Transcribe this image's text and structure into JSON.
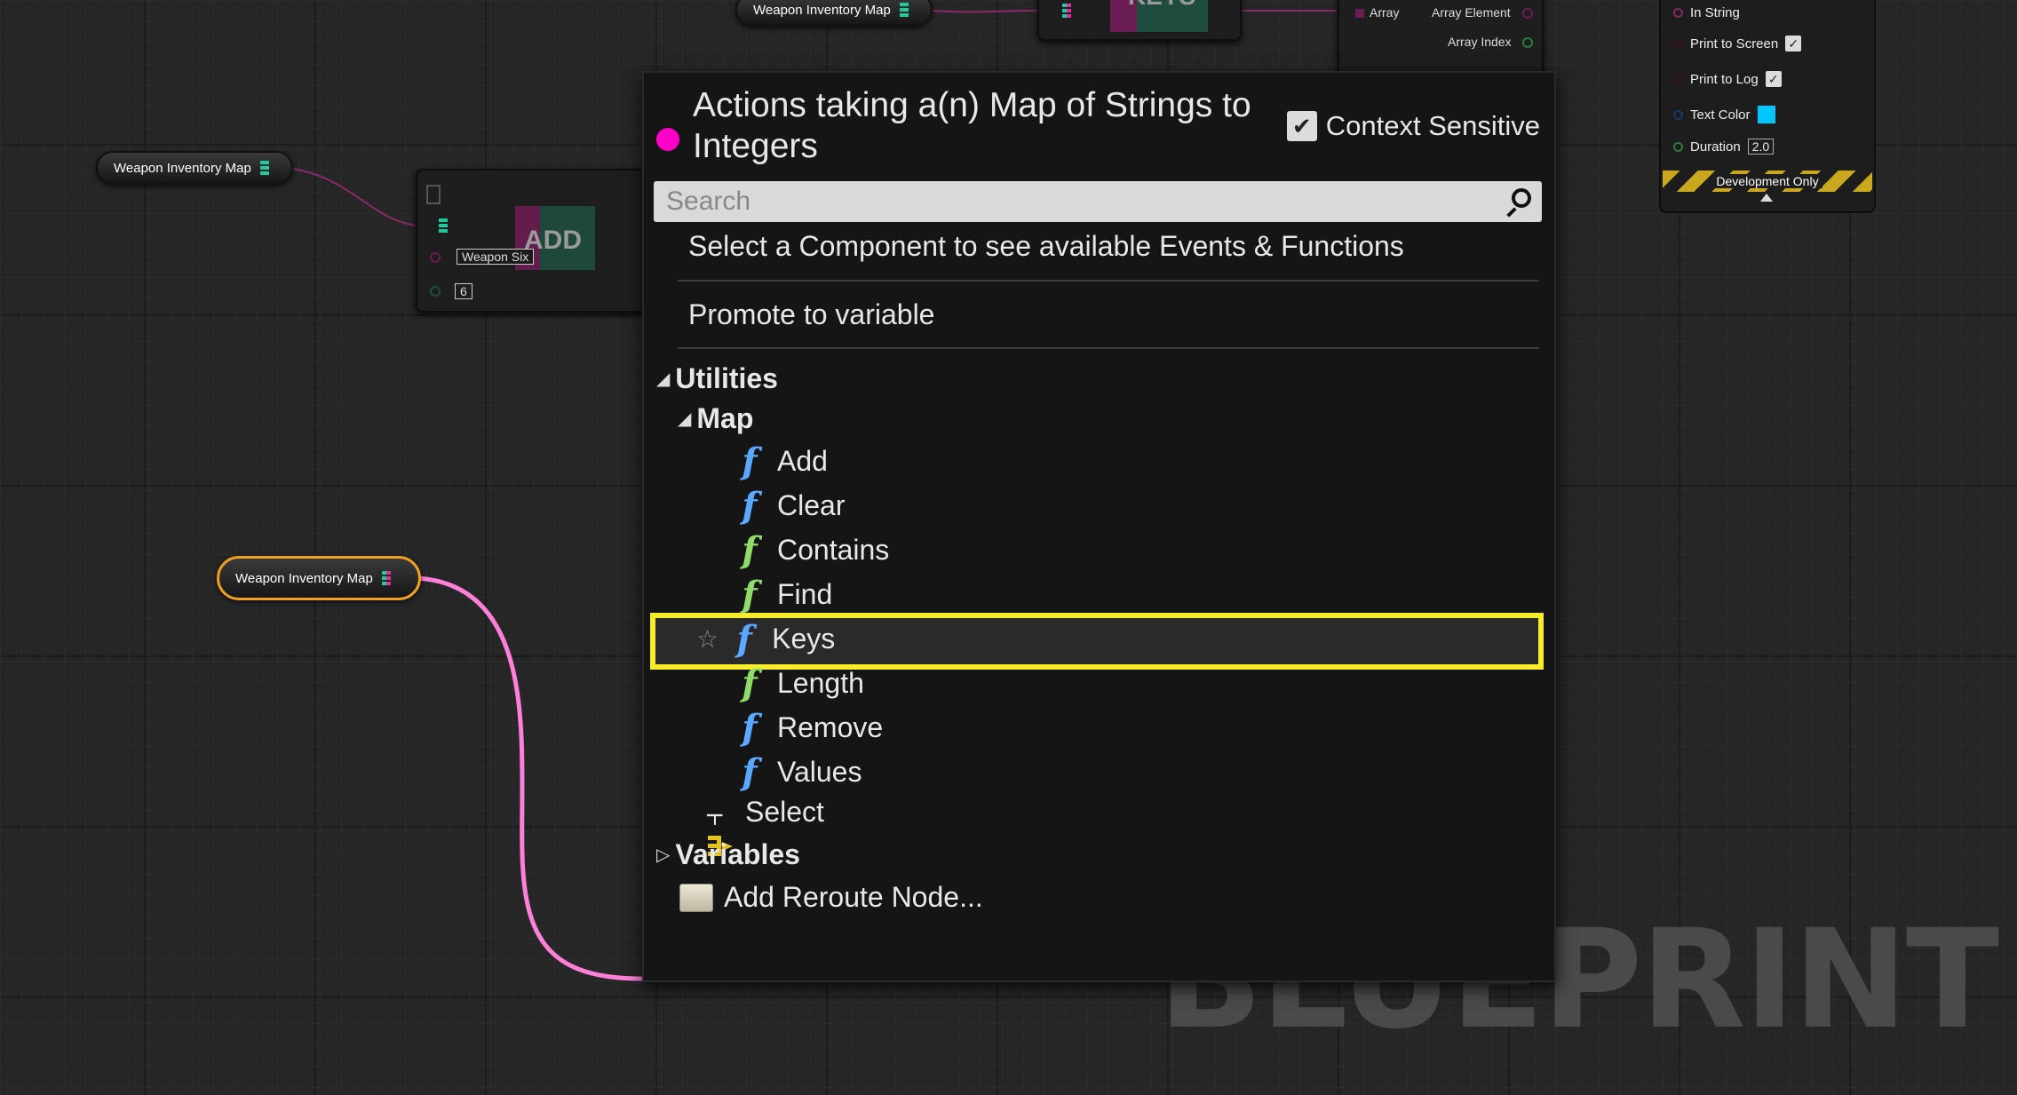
{
  "graph": {
    "watermark": "BLUEPRINT",
    "nodes": {
      "var_top_center": {
        "label": "Weapon Inventory Map"
      },
      "var_top_left": {
        "label": "Weapon Inventory Map"
      },
      "var_selected": {
        "label": "Weapon Inventory Map"
      },
      "add_node": {
        "title": "ADD",
        "key_value": "Weapon Six",
        "int_value": "6"
      },
      "keys_node": {
        "title": "KEYS"
      },
      "foreach_node": {
        "array_label": "Array",
        "element_label": "Array Element",
        "index_label": "Array Index"
      },
      "print_node": {
        "in_string": "In String",
        "print_to_screen": "Print to Screen",
        "print_to_log": "Print to Log",
        "text_color": "Text Color",
        "text_color_value": "#00c8ff",
        "duration": "Duration",
        "duration_value": "2.0",
        "development_only": "Development Only"
      }
    },
    "colors": {
      "map_wire": "#ff6ed6",
      "map_pin_key": "#e0309a",
      "map_pin_value": "#21c9a0"
    }
  },
  "context_menu": {
    "title": "Actions taking a(n) Map of Strings to Integers",
    "context_sensitive_label": "Context Sensitive",
    "context_sensitive_checked": true,
    "search": {
      "placeholder": "Search",
      "value": ""
    },
    "actions": [
      "Select a Component to see available Events & Functions",
      "Promote to variable"
    ],
    "tree": {
      "category": "Utilities",
      "subcategory": "Map",
      "functions": [
        {
          "label": "Add",
          "icon": "function-icon",
          "color": "blue"
        },
        {
          "label": "Clear",
          "icon": "function-icon",
          "color": "blue"
        },
        {
          "label": "Contains",
          "icon": "pure-function-icon",
          "color": "green"
        },
        {
          "label": "Find",
          "icon": "pure-function-icon",
          "color": "green"
        },
        {
          "label": "Keys",
          "icon": "function-icon",
          "color": "blue",
          "highlighted": true
        },
        {
          "label": "Length",
          "icon": "pure-function-icon",
          "color": "green"
        },
        {
          "label": "Remove",
          "icon": "function-icon",
          "color": "blue"
        },
        {
          "label": "Values",
          "icon": "function-icon",
          "color": "blue"
        }
      ],
      "select_label": "Select",
      "variables_label": "Variables",
      "reroute_label": "Add Reroute Node..."
    },
    "highlight_color": "#f7ec2a"
  }
}
